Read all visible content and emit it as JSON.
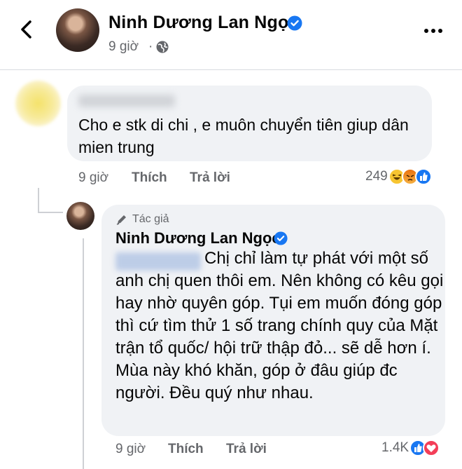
{
  "header": {
    "back_icon": "chevron-left-icon",
    "page_name": "Ninh Dương Lan Ngọc",
    "post_time": "9 giờ",
    "separator": "·",
    "privacy_icon": "globe-icon",
    "more_icon": "ellipsis-icon",
    "verified_color": "#1877f2"
  },
  "comment1": {
    "text": "Cho e stk di chi , e muôn chuyển tiên giup dân mien trung",
    "time": "9 giờ",
    "like_label": "Thích",
    "reply_label": "Trả lời",
    "reaction_count": "249",
    "reactions": [
      "haha-icon",
      "angry-icon",
      "like-icon"
    ]
  },
  "reply1": {
    "author_tag": "Tác giả",
    "author_name": "Ninh Dương Lan Ngọc",
    "text": "Chị chỉ làm tự phát với một số anh chị quen thôi em. Nên không có kêu gọi hay nhờ quyên góp. Tụi em muốn đóng góp thì cứ tìm thử 1 số trang chính quy của Mặt trận tổ quốc/ hội trữ thập đỏ... sẽ dễ hơn í. Mùa này khó khăn, góp ở đâu giúp đc người. Đều quý như nhau.",
    "time": "9 giờ",
    "like_label": "Thích",
    "reply_label": "Trả lời",
    "reaction_count": "1.4K",
    "reactions": [
      "like-icon",
      "love-icon"
    ]
  },
  "colors": {
    "bubble": "#f0f2f5",
    "meta_text": "#65676b",
    "like_blue": "#1877f2",
    "love_red": "#f33e58",
    "haha_yellow": "#f7c531"
  }
}
